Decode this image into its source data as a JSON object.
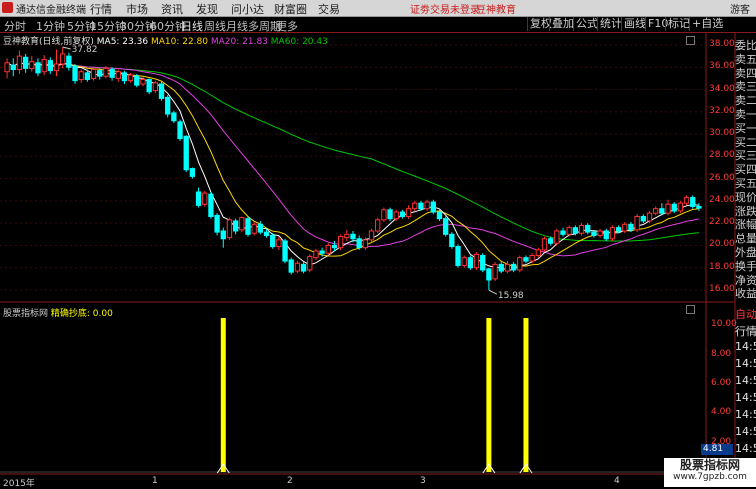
{
  "titlebar": {
    "app_name": "通达信金融终端",
    "menus": [
      "行情",
      "市场",
      "资讯",
      "发现",
      "问小达",
      "财富圈",
      "交易"
    ],
    "login_link": "证劵交易未登录",
    "edu_link": "豆神教育",
    "user": "游客"
  },
  "toolbar": {
    "periods": [
      "分时",
      "1分钟",
      "5分钟",
      "15分钟",
      "30分钟",
      "60分钟",
      "日线",
      "周线",
      "月线",
      "多周期",
      "更多"
    ],
    "active_period": "日线",
    "right_buttons": [
      "复权",
      "叠加",
      "画线",
      "F10",
      "标记",
      "+自选"
    ],
    "right_buttons2": [
      "公式",
      "统计"
    ]
  },
  "legend": {
    "stock": "豆神教育(日线,前复权)",
    "ma5": "MA5: 23.36",
    "ma10": "MA10: 22.80",
    "ma20": "MA20: 21.83",
    "ma60": "MA60: 20.43"
  },
  "indicator_legend": {
    "name": "股票指标网",
    "formula": "精确抄底: 0.00"
  },
  "annotations": {
    "high": "37.82",
    "low": "15.98"
  },
  "price_axis": [
    "38.00",
    "36.00",
    "34.00",
    "32.00",
    "30.00",
    "28.00",
    "26.00",
    "24.00",
    "22.00",
    "20.00",
    "18.00",
    "16.00"
  ],
  "ind_axis": [
    "10.00",
    "8.00",
    "6.00",
    "4.00",
    "2.00"
  ],
  "current_value": "4.81",
  "date_axis": [
    "2015年",
    "1",
    "2",
    "3",
    "4"
  ],
  "side_labels": [
    "委比",
    "卖五",
    "卖四",
    "卖三",
    "卖二",
    "卖一",
    "买一",
    "买二",
    "买三",
    "买四",
    "买五",
    "现价",
    "涨跌",
    "涨幅",
    "总量",
    "外盘",
    "换手",
    "净资",
    "收益"
  ],
  "side_labels2": [
    "自动",
    "行情",
    "14:5",
    "14:5",
    "14:5",
    "14:5",
    "14:5",
    "14:5",
    "14:5",
    "14:5"
  ],
  "watermark": {
    "line1": "股票指标网",
    "line2": "www.7gpzb.com"
  },
  "colors": {
    "up": "#ff3232",
    "down": "#00ffff",
    "ma5": "#ffffff",
    "ma10": "#ffd700",
    "ma20": "#e040e0",
    "ma60": "#00c800",
    "signal": "#ffff00"
  },
  "chart_data": [
    {
      "type": "candlestick",
      "title": "豆神教育(日线,前复权)",
      "ylim": [
        15.0,
        39.0
      ],
      "candles": [
        [
          35.6,
          36.4,
          35.0,
          36.8
        ],
        [
          36.2,
          35.8,
          35.2,
          36.8
        ],
        [
          35.8,
          37.0,
          35.4,
          37.5
        ],
        [
          36.9,
          35.9,
          35.5,
          37.2
        ],
        [
          35.9,
          36.5,
          35.6,
          37.0
        ],
        [
          36.4,
          35.5,
          35.2,
          36.8
        ],
        [
          35.6,
          36.7,
          35.3,
          37.1
        ],
        [
          36.6,
          35.7,
          35.4,
          36.9
        ],
        [
          35.7,
          36.3,
          35.2,
          37.6
        ],
        [
          36.3,
          37.2,
          35.9,
          37.82
        ],
        [
          37.0,
          36.0,
          35.7,
          37.3
        ],
        [
          36.1,
          34.8,
          34.5,
          36.3
        ],
        [
          34.9,
          35.6,
          34.6,
          35.8
        ],
        [
          35.5,
          34.9,
          34.7,
          35.8
        ],
        [
          35.0,
          35.8,
          34.8,
          36.0
        ],
        [
          35.7,
          35.2,
          34.9,
          35.9
        ],
        [
          35.2,
          35.9,
          35.0,
          36.1
        ],
        [
          35.8,
          35.1,
          34.8,
          36.0
        ],
        [
          35.0,
          35.6,
          34.7,
          35.8
        ],
        [
          35.5,
          34.8,
          34.5,
          35.7
        ],
        [
          34.8,
          35.3,
          34.6,
          35.5
        ],
        [
          35.2,
          34.4,
          34.2,
          35.4
        ],
        [
          34.5,
          34.9,
          34.3,
          35.1
        ],
        [
          34.9,
          33.8,
          33.6,
          35.0
        ],
        [
          33.9,
          34.6,
          33.7,
          34.8
        ],
        [
          34.5,
          33.2,
          33.0,
          34.7
        ],
        [
          33.3,
          31.8,
          31.5,
          33.5
        ],
        [
          31.9,
          31.2,
          31.0,
          32.1
        ],
        [
          31.1,
          29.6,
          29.4,
          31.3
        ],
        [
          29.8,
          26.8,
          26.6,
          29.9
        ],
        [
          26.9,
          26.2,
          26.0,
          27.0
        ],
        [
          24.8,
          23.6,
          23.4,
          25.2
        ],
        [
          23.7,
          24.7,
          23.5,
          24.9
        ],
        [
          24.6,
          22.6,
          22.4,
          24.8
        ],
        [
          22.7,
          21.2,
          20.9,
          22.9
        ],
        [
          21.3,
          20.6,
          19.8,
          21.6
        ],
        [
          20.7,
          22.3,
          20.5,
          22.5
        ],
        [
          22.2,
          21.3,
          21.0,
          22.4
        ],
        [
          21.4,
          22.5,
          21.2,
          22.6
        ],
        [
          22.4,
          21.0,
          20.8,
          22.6
        ],
        [
          21.1,
          21.9,
          20.9,
          22.1
        ],
        [
          21.9,
          21.2,
          21.0,
          22.2
        ],
        [
          21.2,
          20.9,
          20.7,
          21.5
        ],
        [
          20.9,
          19.9,
          19.7,
          21.1
        ],
        [
          19.9,
          20.5,
          19.6,
          20.8
        ],
        [
          20.4,
          18.6,
          18.4,
          20.6
        ],
        [
          18.7,
          17.6,
          17.4,
          18.9
        ],
        [
          17.7,
          18.4,
          17.5,
          18.6
        ],
        [
          18.3,
          17.7,
          17.5,
          18.5
        ],
        [
          17.8,
          19.0,
          17.6,
          19.2
        ],
        [
          18.9,
          19.5,
          18.7,
          19.7
        ],
        [
          19.5,
          19.3,
          19.0,
          19.8
        ],
        [
          19.3,
          20.0,
          19.1,
          20.2
        ],
        [
          20.0,
          19.8,
          19.5,
          20.4
        ],
        [
          19.8,
          20.8,
          19.6,
          21.0
        ],
        [
          20.7,
          21.0,
          20.4,
          21.4
        ],
        [
          21.0,
          20.6,
          20.3,
          21.3
        ],
        [
          20.6,
          19.8,
          19.6,
          20.9
        ],
        [
          19.8,
          20.5,
          19.6,
          20.7
        ],
        [
          20.5,
          21.3,
          20.3,
          21.5
        ],
        [
          21.3,
          22.3,
          21.1,
          22.5
        ],
        [
          22.3,
          23.2,
          22.1,
          23.4
        ],
        [
          23.2,
          22.4,
          22.2,
          23.4
        ],
        [
          22.4,
          23.0,
          22.2,
          23.2
        ],
        [
          23.0,
          22.6,
          22.4,
          23.2
        ],
        [
          22.6,
          23.3,
          22.4,
          23.6
        ],
        [
          23.3,
          23.8,
          23.1,
          24.0
        ],
        [
          23.8,
          23.3,
          23.1,
          24.0
        ],
        [
          23.3,
          23.9,
          23.1,
          24.1
        ],
        [
          23.9,
          23.0,
          22.8,
          24.1
        ],
        [
          23.0,
          22.4,
          22.2,
          23.2
        ],
        [
          22.4,
          21.0,
          20.8,
          22.6
        ],
        [
          21.0,
          19.9,
          19.7,
          21.2
        ],
        [
          19.9,
          18.2,
          18.0,
          20.1
        ],
        [
          18.2,
          18.9,
          18.0,
          19.1
        ],
        [
          18.9,
          18.0,
          17.8,
          19.1
        ],
        [
          18.0,
          19.2,
          17.8,
          19.4
        ],
        [
          19.1,
          17.8,
          17.6,
          19.3
        ],
        [
          17.9,
          16.9,
          15.98,
          18.0
        ],
        [
          17.0,
          18.3,
          16.8,
          18.5
        ],
        [
          18.3,
          17.7,
          17.5,
          18.5
        ],
        [
          17.7,
          18.3,
          17.5,
          18.6
        ],
        [
          18.3,
          17.8,
          17.6,
          18.5
        ],
        [
          17.8,
          18.9,
          17.6,
          19.1
        ],
        [
          18.9,
          18.6,
          18.4,
          19.1
        ],
        [
          18.6,
          19.1,
          18.4,
          19.3
        ],
        [
          19.1,
          19.6,
          18.9,
          19.8
        ],
        [
          19.6,
          20.6,
          19.4,
          20.8
        ],
        [
          20.6,
          20.2,
          20.0,
          20.8
        ],
        [
          20.2,
          21.3,
          20.0,
          21.5
        ],
        [
          21.3,
          21.0,
          20.8,
          21.6
        ],
        [
          21.0,
          21.6,
          20.8,
          21.8
        ],
        [
          21.6,
          21.1,
          20.9,
          21.8
        ],
        [
          21.1,
          21.8,
          20.9,
          22.0
        ],
        [
          21.8,
          21.2,
          21.0,
          22.0
        ],
        [
          21.2,
          20.9,
          20.7,
          21.4
        ],
        [
          20.9,
          21.3,
          20.7,
          21.5
        ],
        [
          21.3,
          20.6,
          20.4,
          21.5
        ],
        [
          20.6,
          21.6,
          20.4,
          21.8
        ],
        [
          21.6,
          21.3,
          21.1,
          21.8
        ],
        [
          21.3,
          21.9,
          21.1,
          22.1
        ],
        [
          21.9,
          21.4,
          21.2,
          22.1
        ],
        [
          21.4,
          22.6,
          21.2,
          22.8
        ],
        [
          22.6,
          22.2,
          22.0,
          22.8
        ],
        [
          22.2,
          22.9,
          22.0,
          23.1
        ],
        [
          22.9,
          23.3,
          22.7,
          23.5
        ],
        [
          23.3,
          22.9,
          22.7,
          23.8
        ],
        [
          22.9,
          23.7,
          22.7,
          24.1
        ],
        [
          23.7,
          23.1,
          22.9,
          23.9
        ],
        [
          23.1,
          23.8,
          22.9,
          24.0
        ],
        [
          23.8,
          24.3,
          23.6,
          24.5
        ],
        [
          24.3,
          23.5,
          23.3,
          24.5
        ],
        [
          23.5,
          23.36,
          23.1,
          23.8
        ]
      ],
      "ma5_last": 23.36,
      "ma10_last": 22.8,
      "ma20_last": 21.83,
      "ma60_last": 20.43
    },
    {
      "type": "bar",
      "title": "精确抄底",
      "ylim": [
        0,
        10.5
      ],
      "signals": [
        {
          "index": 35,
          "value": 10.5
        },
        {
          "index": 78,
          "value": 10.5
        },
        {
          "index": 84,
          "value": 10.5
        }
      ]
    }
  ]
}
